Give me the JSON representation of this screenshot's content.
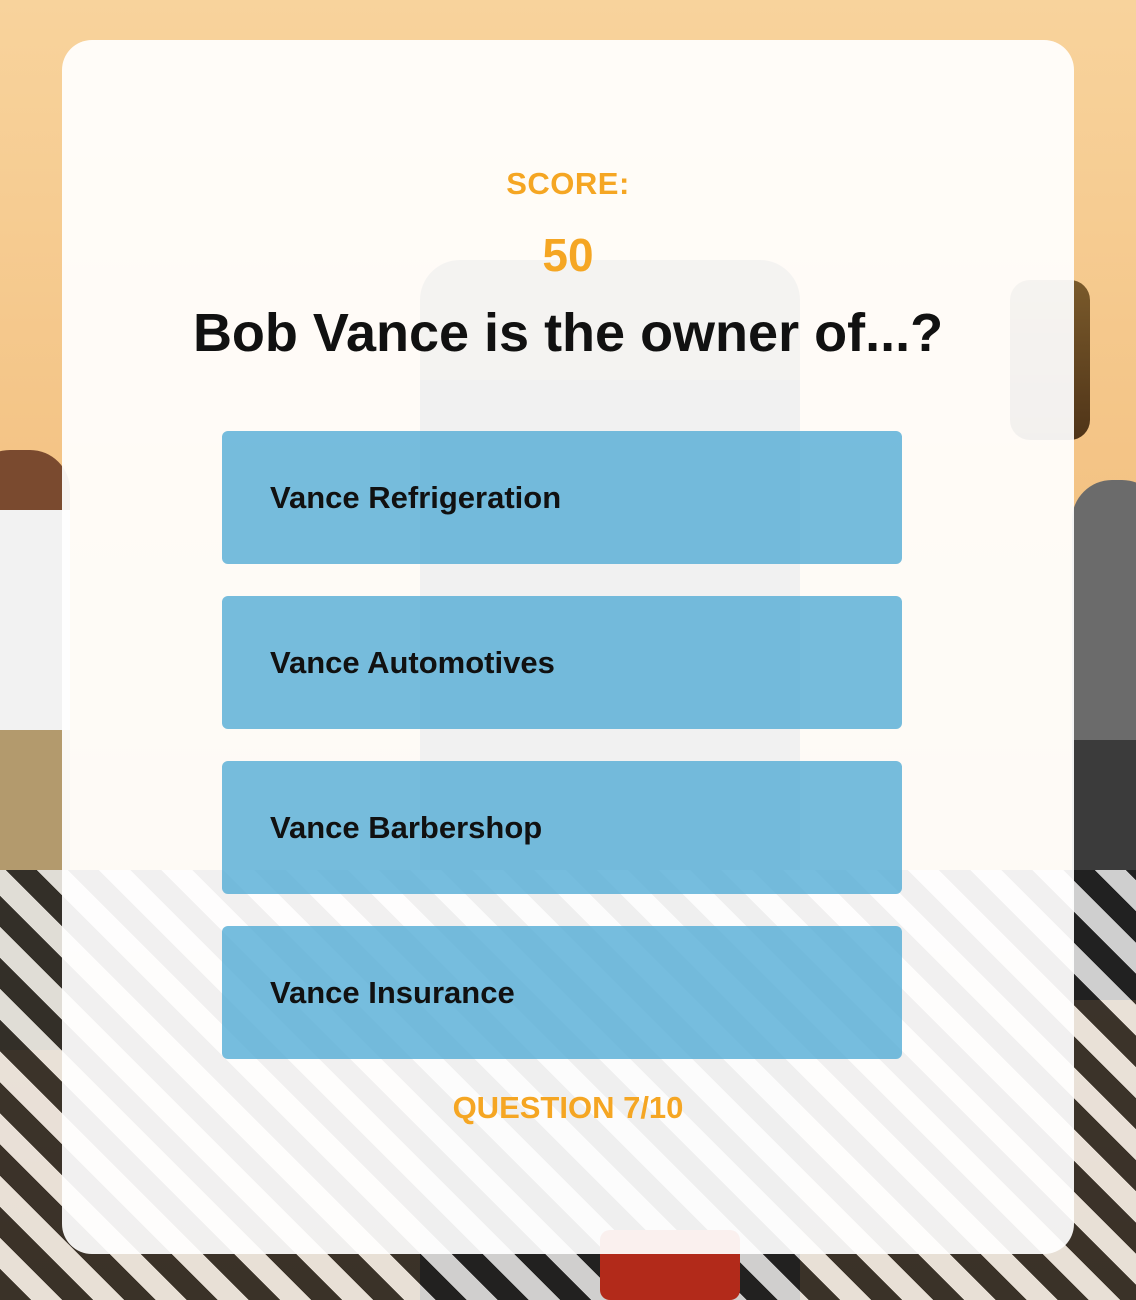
{
  "quiz": {
    "score_label": "SCORE:",
    "score_value": "50",
    "question": "Bob Vance is the owner of...?",
    "answers": [
      {
        "label": "Vance Refrigeration"
      },
      {
        "label": "Vance Automotives"
      },
      {
        "label": "Vance Barbershop"
      },
      {
        "label": "Vance Insurance"
      }
    ],
    "progress": "QUESTION 7/10"
  },
  "colors": {
    "accent": "#f5a623",
    "answer_bg": "#54acd6",
    "text": "#111111"
  }
}
